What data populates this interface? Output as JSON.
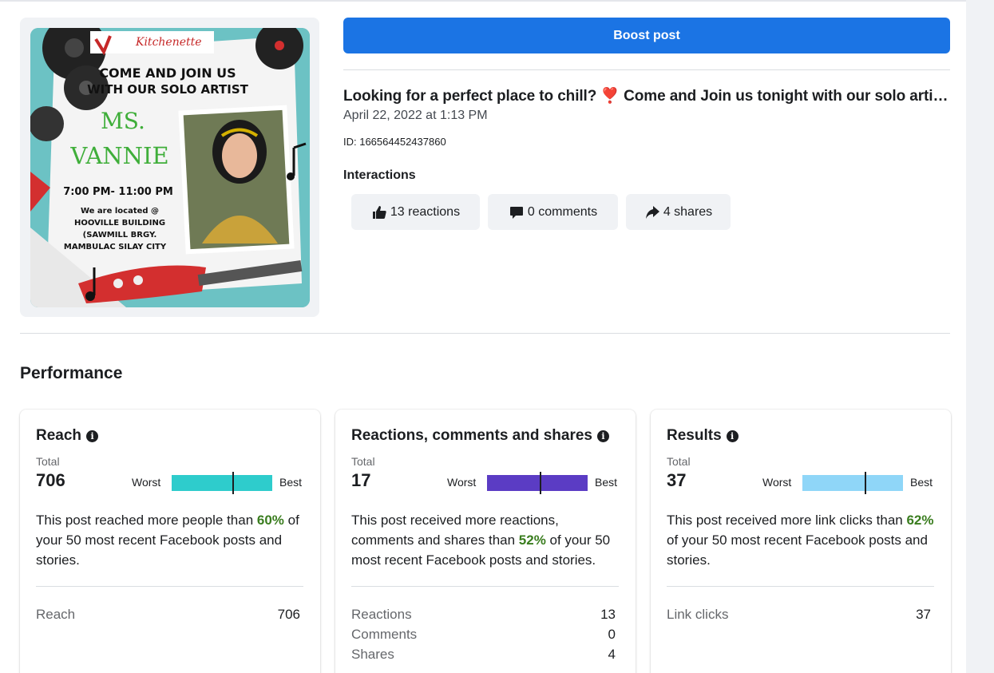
{
  "post": {
    "boost_label": "Boost post",
    "title": "Looking for a perfect place to chill? ❣️ Come and Join us tonight with our solo arti…",
    "date": "April 22, 2022 at 1:13 PM",
    "id": "ID: 166564452437860",
    "image": {
      "brand": "Kitchenette",
      "line1": "COME AND JOIN US",
      "line2": "WITH OUR SOLO ARTIST",
      "name1": "MS.",
      "name2": "VANNIE",
      "time": "7:00 PM- 11:00 PM",
      "loc1": "We are located @",
      "loc2": "HOOVILLE BUILDING",
      "loc3": "(SAWMILL BRGY.",
      "loc4": "MAMBULAC SILAY CITY"
    }
  },
  "interactions": {
    "title": "Interactions",
    "reactions": "13 reactions",
    "comments": "0 comments",
    "shares": "4 shares"
  },
  "performance": {
    "title": "Performance",
    "cards": [
      {
        "title": "Reach",
        "total_label": "Total",
        "total": "706",
        "worst": "Worst",
        "best": "Best",
        "bar_color": "#2ecccc",
        "marker_fraction": 0.61,
        "desc_before": "This post reached more people than ",
        "pct": "60%",
        "desc_after": " of your 50 most recent Facebook posts and stories.",
        "rows": [
          {
            "label": "Reach",
            "value": "706"
          }
        ]
      },
      {
        "title": "Reactions, comments and shares",
        "total_label": "Total",
        "total": "17",
        "worst": "Worst",
        "best": "Best",
        "bar_color": "#5b3cc4",
        "marker_fraction": 0.53,
        "desc_before": "This post received more reactions, comments and shares than ",
        "pct": "52%",
        "desc_after": " of your 50 most recent Facebook posts and stories.",
        "rows": [
          {
            "label": "Reactions",
            "value": "13"
          },
          {
            "label": "Comments",
            "value": "0"
          },
          {
            "label": "Shares",
            "value": "4"
          }
        ]
      },
      {
        "title": "Results",
        "total_label": "Total",
        "total": "37",
        "worst": "Worst",
        "best": "Best",
        "bar_color": "#8fd6f8",
        "marker_fraction": 0.63,
        "desc_before": "This post received more link clicks than ",
        "pct": "62%",
        "desc_after": " of your 50 most recent Facebook posts and stories.",
        "rows": [
          {
            "label": "Link clicks",
            "value": "37"
          }
        ]
      }
    ]
  },
  "colors": {
    "accent": "#1b74e4",
    "positive": "#3a7d1f"
  }
}
